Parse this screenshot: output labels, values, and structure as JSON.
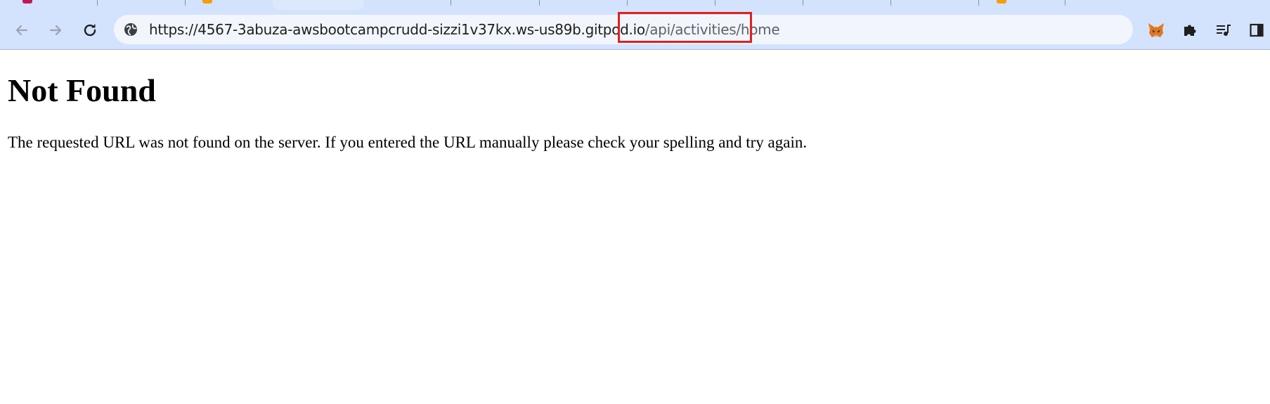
{
  "browser": {
    "address_bar": {
      "url_host": "https://4567-3abuza-awsbootcampcrudd-sizzi1v37kx.ws-us89b.gitpod.io",
      "url_path": "/api/activities/home"
    },
    "icons": {
      "back": "back-arrow-icon",
      "forward": "forward-arrow-icon",
      "reload": "reload-icon",
      "site_info": "site-info-icon",
      "metamask": "metamask-fox-icon",
      "extensions": "puzzle-piece-icon",
      "reading_list": "media-queue-icon",
      "side_panel": "side-panel-icon"
    }
  },
  "page": {
    "heading": "Not Found",
    "message": "The requested URL was not found on the server. If you entered the URL manually please check your spelling and try again."
  },
  "annotation": {
    "highlight_color": "#e02020"
  }
}
